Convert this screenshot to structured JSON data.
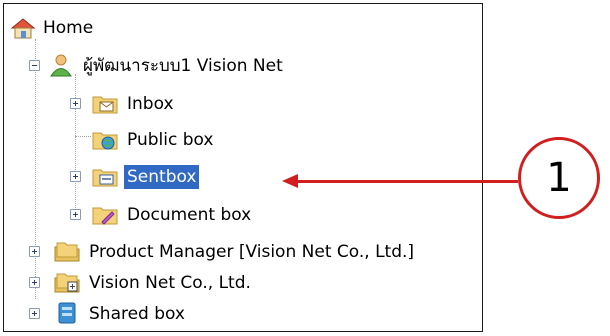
{
  "tree": {
    "home": {
      "label": "Home",
      "icon": "home-icon"
    },
    "user": {
      "label": "ผู้พัฒนาระบบ1 Vision Net",
      "icon": "user-icon"
    },
    "inbox": {
      "label": "Inbox",
      "icon": "inbox-folder-icon"
    },
    "public_box": {
      "label": "Public box",
      "icon": "public-folder-icon"
    },
    "sentbox": {
      "label": "Sentbox",
      "icon": "sent-folder-icon",
      "selected": true
    },
    "document_box": {
      "label": "Document box",
      "icon": "document-folder-icon"
    },
    "product_manager": {
      "label": "Product Manager [Vision Net Co., Ltd.]",
      "icon": "group-folder-icon"
    },
    "vision_net": {
      "label": "Vision Net Co., Ltd.",
      "icon": "organization-folder-icon"
    },
    "shared_box": {
      "label": "Shared box",
      "icon": "shared-box-icon"
    }
  },
  "callout": {
    "number": "1",
    "color": "#d11f1f"
  },
  "colors": {
    "selection": "#316ac5",
    "folder": "#f3d27a"
  }
}
